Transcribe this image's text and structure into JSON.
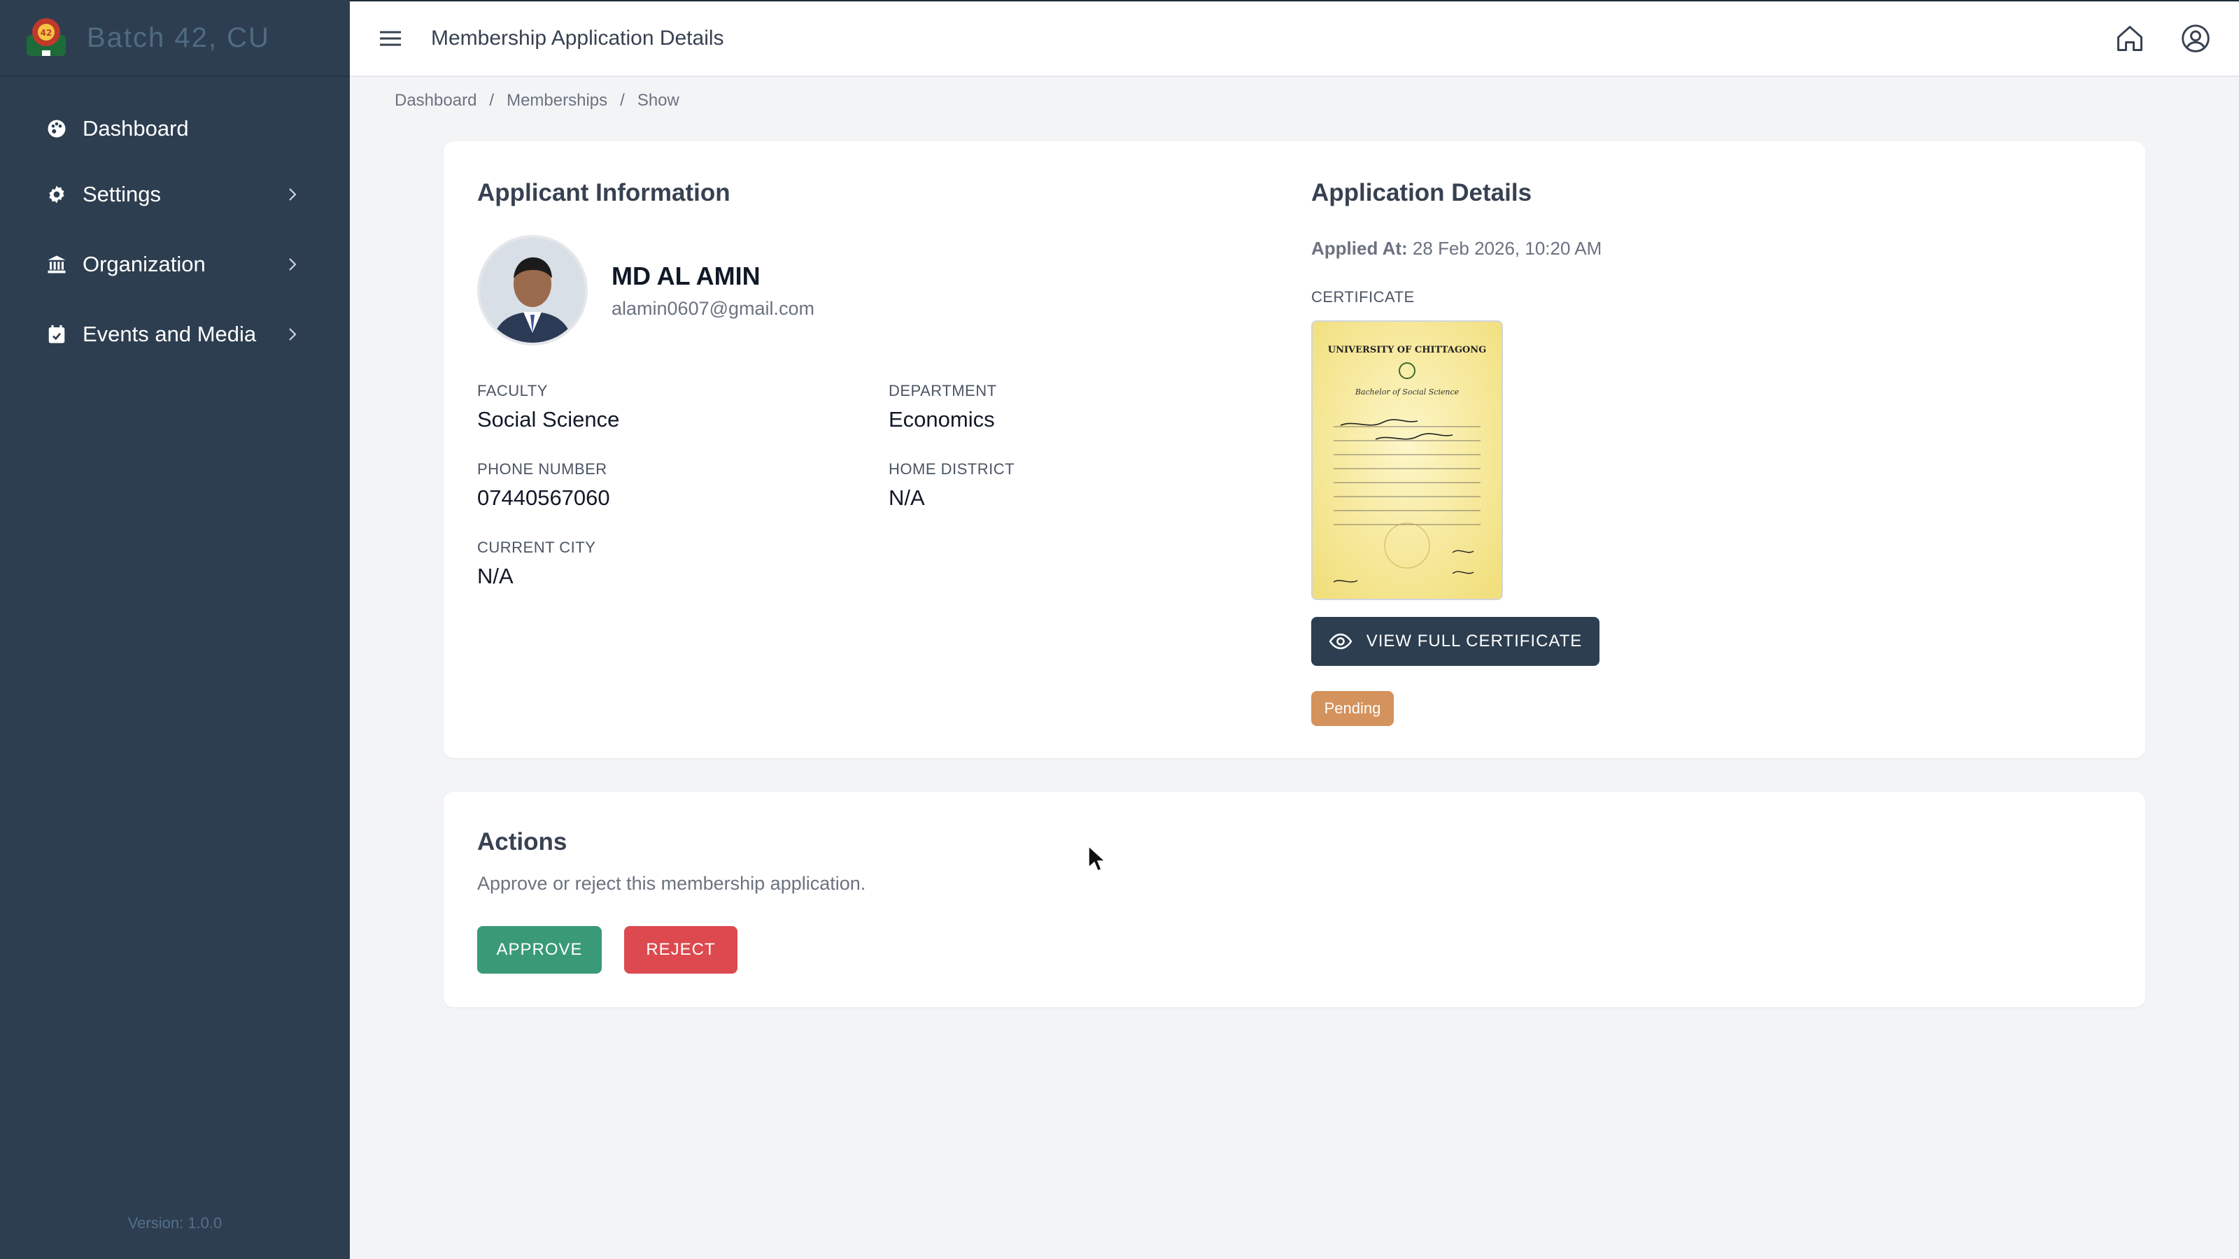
{
  "brand": {
    "name": "Batch 42, CU",
    "logo": "batch-logo"
  },
  "sidebar": {
    "items": [
      {
        "label": "Dashboard",
        "icon": "palette-icon",
        "has_submenu": false
      },
      {
        "label": "Settings",
        "icon": "gear-icon",
        "has_submenu": true
      },
      {
        "label": "Organization",
        "icon": "bank-icon",
        "has_submenu": true
      },
      {
        "label": "Events and Media",
        "icon": "calendar-icon",
        "has_submenu": true
      }
    ],
    "version": "Version: 1.0.0"
  },
  "topbar": {
    "title": "Membership Application Details",
    "icons": [
      "menu-icon",
      "home-icon",
      "user-circle-icon"
    ]
  },
  "breadcrumb": {
    "items": [
      "Dashboard",
      "Memberships",
      "Show"
    ],
    "separator": "/"
  },
  "applicant": {
    "section_title": "Applicant Information",
    "name": "MD AL AMIN",
    "email": "alamin0607@gmail.com",
    "fields": {
      "faculty": {
        "label": "FACULTY",
        "value": "Social Science"
      },
      "department": {
        "label": "DEPARTMENT",
        "value": "Economics"
      },
      "phone": {
        "label": "PHONE NUMBER",
        "value": "07440567060"
      },
      "home_district": {
        "label": "HOME DISTRICT",
        "value": "N/A"
      },
      "current_city": {
        "label": "CURRENT CITY",
        "value": "N/A"
      }
    }
  },
  "application": {
    "section_title": "Application Details",
    "applied_at_label": "Applied At:",
    "applied_at_value": "28 Feb 2026, 10:20 AM",
    "certificate_label": "CERTIFICATE",
    "certificate_heading": "UNIVERSITY OF CHITTAGONG",
    "certificate_degree": "Bachelor of Social Science",
    "view_button": "VIEW FULL CERTIFICATE",
    "status": "Pending"
  },
  "actions": {
    "title": "Actions",
    "description": "Approve or reject this membership application.",
    "approve": "APPROVE",
    "reject": "REJECT"
  },
  "colors": {
    "sidebar_bg": "#2d3e50",
    "primary_dark": "#2c3e50",
    "approve": "#3a9a77",
    "reject": "#dc4a4f",
    "pending": "#d4925c"
  }
}
